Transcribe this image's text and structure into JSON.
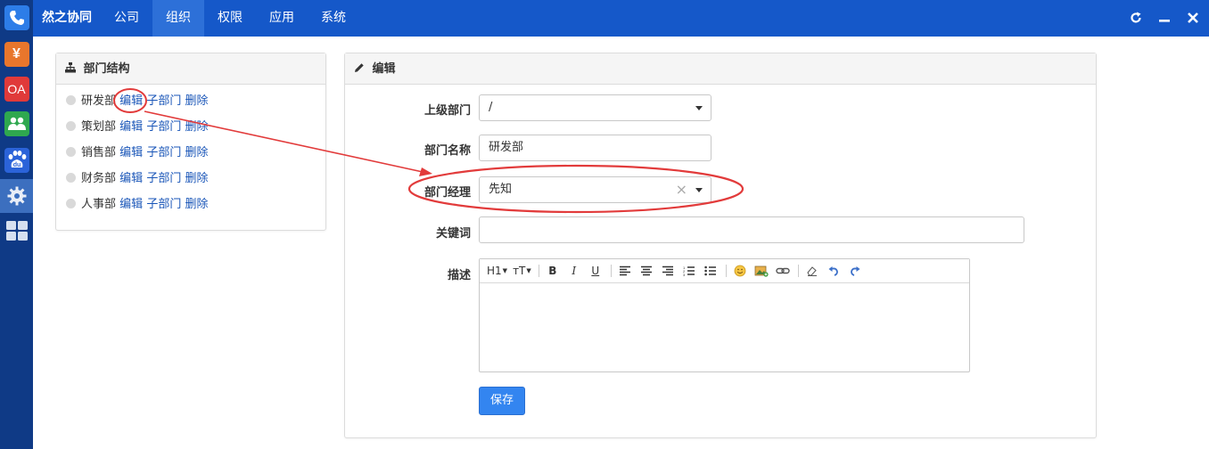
{
  "rail": {
    "items": [
      {
        "icon": "phone-icon",
        "text": ""
      },
      {
        "icon": "yen-icon",
        "text": "¥"
      },
      {
        "icon": "oa-icon",
        "text": "OA"
      },
      {
        "icon": "users-icon",
        "text": ""
      },
      {
        "icon": "baidu-icon",
        "text": "du"
      },
      {
        "icon": "gear-icon",
        "text": ""
      },
      {
        "icon": "apps-grid-icon",
        "text": ""
      }
    ]
  },
  "topbar": {
    "brand": "然之协同",
    "nav": [
      "公司",
      "组织",
      "权限",
      "应用",
      "系统"
    ],
    "active_nav": "组织"
  },
  "tree_panel": {
    "title": "部门结构",
    "departments": [
      {
        "name": "研发部",
        "edit": "编辑",
        "child": "子部门",
        "delete": "删除"
      },
      {
        "name": "策划部",
        "edit": "编辑",
        "child": "子部门",
        "delete": "删除"
      },
      {
        "name": "销售部",
        "edit": "编辑",
        "child": "子部门",
        "delete": "删除"
      },
      {
        "name": "财务部",
        "edit": "编辑",
        "child": "子部门",
        "delete": "删除"
      },
      {
        "name": "人事部",
        "edit": "编辑",
        "child": "子部门",
        "delete": "删除"
      }
    ]
  },
  "edit_panel": {
    "title": "编辑",
    "parent": {
      "label": "上级部门",
      "value": "/"
    },
    "name": {
      "label": "部门名称",
      "value": "研发部"
    },
    "manager": {
      "label": "部门经理",
      "value": "先知",
      "clear": "×"
    },
    "keywords": {
      "label": "关键词",
      "value": ""
    },
    "desc": {
      "label": "描述",
      "toolbar": [
        "H1",
        "ᴛT",
        "B",
        "I",
        "U"
      ]
    },
    "save": "保存"
  },
  "colors": {
    "topbar": "#1558c9",
    "rail": "#0f3a86",
    "link": "#1a56b8",
    "annotation": "#e23b3b",
    "primary_button": "#3385f0"
  }
}
